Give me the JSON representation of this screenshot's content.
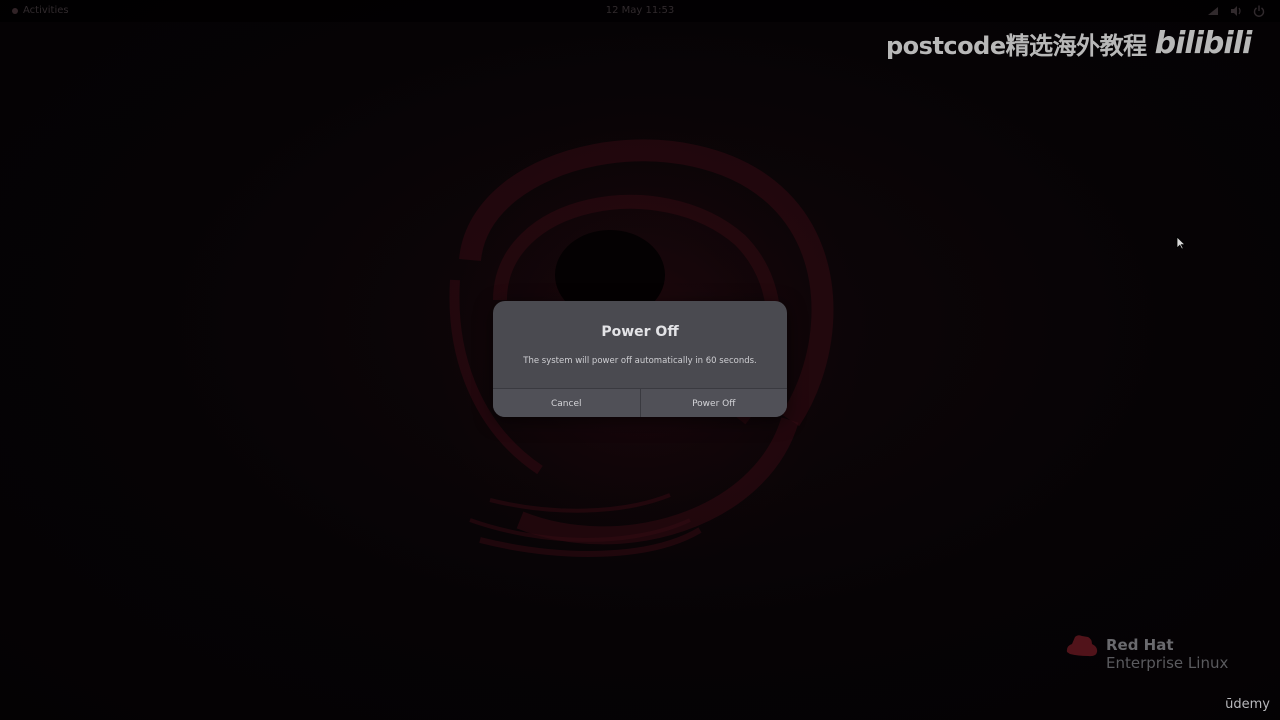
{
  "topbar": {
    "activities_label": "Activities",
    "clock": "12 May 11:53"
  },
  "watermark": {
    "text": "postcode精选海外教程",
    "logo": "bilibili"
  },
  "dialog": {
    "title": "Power Off",
    "message": "The system will power off automatically in 60 seconds.",
    "cancel_label": "Cancel",
    "confirm_label": "Power Off"
  },
  "branding": {
    "line1": "Red Hat",
    "line2": "Enterprise Linux",
    "udemy": "ūdemy"
  },
  "icons": [
    "network-icon",
    "volume-icon",
    "power-icon",
    "red-hat-logo-icon",
    "mouse-pointer-icon"
  ],
  "colors": {
    "dialog_bg": "#4a4a50",
    "accent_red": "#c41e2d"
  }
}
